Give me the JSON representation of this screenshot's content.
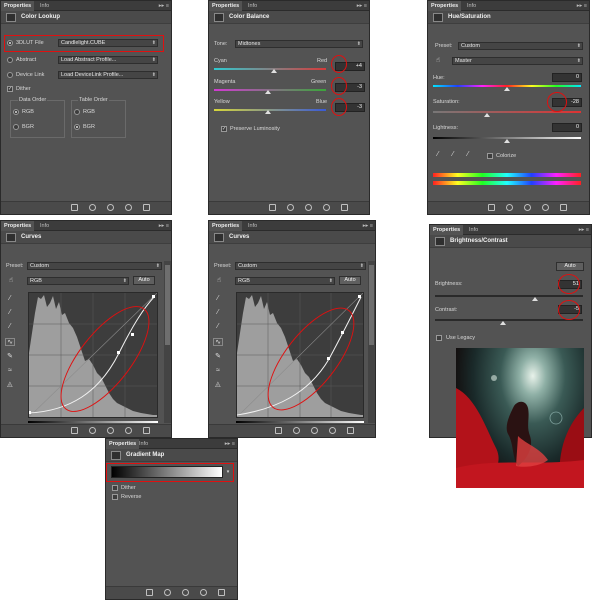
{
  "tabs": {
    "properties": "Properties",
    "info": "Info",
    "menu": "▸▸ ≡"
  },
  "color_lookup": {
    "title": "Color Lookup",
    "lut3d_label": "3DLUT File",
    "lut3d_value": "Candlelight.CUBE",
    "abstract_label": "Abstract",
    "abstract_value": "Load Abstract Profile...",
    "devicelink_label": "Device Link",
    "devicelink_value": "Load DeviceLink Profile...",
    "dither_label": "Dither",
    "data_order_label": "Data Order",
    "table_order_label": "Table Order",
    "rgb": "RGB",
    "bgr": "BGR"
  },
  "color_balance": {
    "title": "Color Balance",
    "tone_label": "Tone:",
    "tone_value": "Midtones",
    "cyan": "Cyan",
    "red": "Red",
    "red_value": "+4",
    "magenta": "Magenta",
    "green": "Green",
    "green_value": "-3",
    "yellow": "Yellow",
    "blue": "Blue",
    "blue_value": "-3",
    "preserve_label": "Preserve Luminosity",
    "colors": {
      "red_slider": "#d63a3a",
      "green_slider": "#3aa63a",
      "blue_slider": "#3a5ad6"
    }
  },
  "hue_saturation": {
    "title": "Hue/Saturation",
    "preset_label": "Preset:",
    "preset_value": "Custom",
    "channel_value": "Master",
    "hue_label": "Hue:",
    "hue_value": "0",
    "saturation_label": "Saturation:",
    "saturation_value": "-28",
    "lightness_label": "Lightness:",
    "lightness_value": "0",
    "colorize_label": "Colorize"
  },
  "curves1": {
    "title": "Curves",
    "preset_label": "Preset:",
    "preset_value": "Custom",
    "channel_value": "RGB",
    "auto_label": "Auto"
  },
  "curves2": {
    "title": "Curves",
    "preset_label": "Preset:",
    "preset_value": "Custom",
    "channel_value": "RGB",
    "auto_label": "Auto"
  },
  "brightness_contrast": {
    "title": "Brightness/Contrast",
    "auto_label": "Auto",
    "brightness_label": "Brightness:",
    "brightness_value": "51",
    "contrast_label": "Contrast:",
    "contrast_value": "-5",
    "legacy_label": "Use Legacy"
  },
  "gradient_map": {
    "title": "Gradient Map",
    "dither_label": "Dither",
    "reverse_label": "Reverse"
  },
  "accent": {
    "highlight": "#e01010",
    "panel_bg": "#535353"
  }
}
